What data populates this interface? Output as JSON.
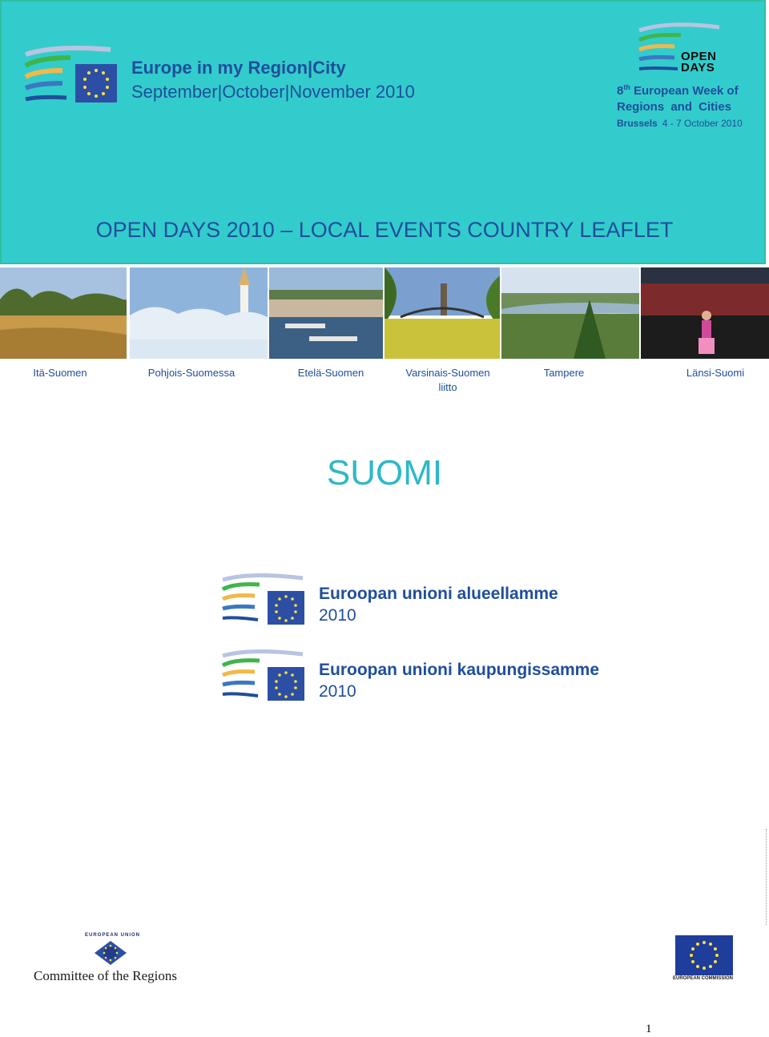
{
  "header": {
    "tagline_line1": "Europe in my Region|City",
    "tagline_line2": "September|October|November 2010",
    "open_days_logo_text": [
      "OPEN",
      "DAYS"
    ],
    "week_line1_num": "8",
    "week_line1_sup": "th",
    "week_line1_rest": " European Week of",
    "week_line2": "Regions  and  Cities",
    "week_line3_city": "Brussels",
    "week_line3_dates": "4 - 7 October 2010",
    "title": "OPEN DAYS 2010 – LOCAL EVENTS  COUNTRY LEAFLET"
  },
  "photo_captions": [
    {
      "text": "Itä-Suomen"
    },
    {
      "text": "Pohjois-Suomessa"
    },
    {
      "text": "Etelä-Suomen"
    },
    {
      "text": "Varsinais-Suomen liitto"
    },
    {
      "text": "Tampere"
    },
    {
      "text": "Länsi-Suomi"
    }
  ],
  "country": "SUOMI",
  "campaigns": [
    {
      "line1": "Euroopan unioni alueellamme",
      "line2": "2010"
    },
    {
      "line1": "Euroopan unioni kaupungissamme",
      "line2": "2010"
    }
  ],
  "footer": {
    "cor_eu_label": "EUROPEAN UNION",
    "cor_name": "Committee of the Regions",
    "ec_label": "EUROPEAN COMMISSION",
    "page_number": "1"
  },
  "colors": {
    "banner": "#33cccc",
    "text_blue": "#1f4e9c",
    "country_teal": "#2eb8c8"
  }
}
